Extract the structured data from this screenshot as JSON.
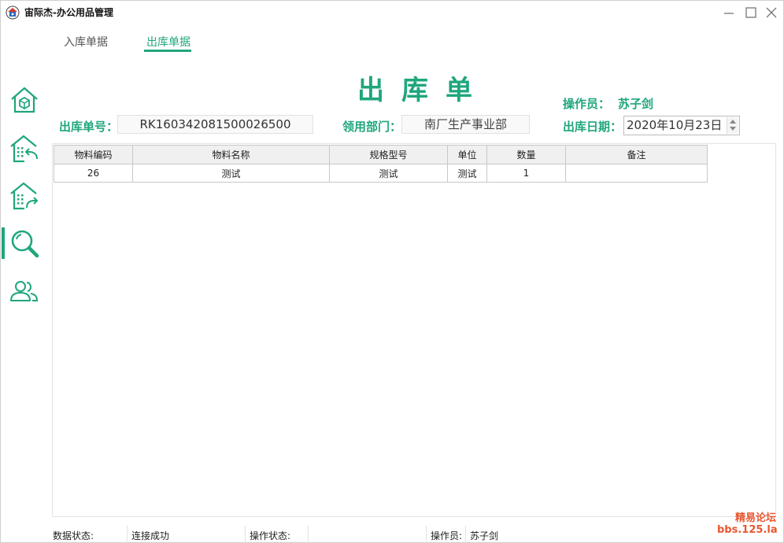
{
  "window": {
    "title": "宙际杰-办公用品管理",
    "colors": {
      "accent": "#1fa67d",
      "watermark": "#e8572f"
    }
  },
  "tabs": [
    {
      "label": "入库单据",
      "active": false
    },
    {
      "label": "出库单据",
      "active": true
    }
  ],
  "sidebar": {
    "items": [
      {
        "icon": "home-icon",
        "active": false
      },
      {
        "icon": "building-return-icon",
        "active": false
      },
      {
        "icon": "building-share-icon",
        "active": false
      },
      {
        "icon": "search-icon",
        "active": true
      },
      {
        "icon": "users-icon",
        "active": false
      }
    ]
  },
  "header": {
    "title": "出库单",
    "operator_label": "操作员：",
    "operator_name": "苏子剑",
    "fields": {
      "order_no_label": "出库单号：",
      "order_no_value": "RK160342081500026500",
      "dept_label": "领用部门：",
      "dept_value": "南厂生产事业部",
      "date_label": "出库日期：",
      "date_value": "2020年10月23日"
    }
  },
  "grid": {
    "columns": [
      "物料编码",
      "物料名称",
      "规格型号",
      "单位",
      "数量",
      "备注"
    ],
    "rows": [
      [
        "26",
        "测试",
        "测试",
        "测试",
        "1",
        ""
      ]
    ]
  },
  "status_bar": {
    "data_status_label": "数据状态:",
    "data_status_value": "连接成功",
    "op_status_label": "操作状态:",
    "op_status_value": "",
    "operator_label": "操作员:",
    "operator_value": "苏子剑"
  },
  "watermark": {
    "line1": "精易论坛",
    "line2": "bbs.125.la"
  }
}
